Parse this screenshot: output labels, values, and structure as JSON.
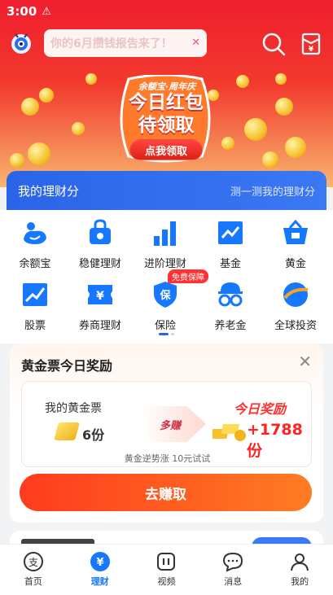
{
  "status_bar": {
    "time": "3:00",
    "indicator": "A-alert-icon"
  },
  "header": {
    "notice_text": "你的6月攒钱报告来了！",
    "icons": [
      "mascot-icon",
      "search-icon",
      "red-envelope-icon"
    ]
  },
  "promo": {
    "tag": "余额宝·周年庆",
    "title_line1": "今日红包",
    "title_line2": "待领取",
    "button": "点我领取"
  },
  "finance_bar": {
    "title": "我的理财分",
    "link": "测一测我的理财分"
  },
  "grid": {
    "items": [
      {
        "label": "余额宝",
        "icon": "yuebao-icon"
      },
      {
        "label": "稳健理财",
        "icon": "lock-bag-icon"
      },
      {
        "label": "进阶理财",
        "icon": "bar-chart-icon"
      },
      {
        "label": "基金",
        "icon": "fund-chart-icon"
      },
      {
        "label": "黄金",
        "icon": "gold-basket-icon"
      },
      {
        "label": "股票",
        "icon": "stock-trend-icon"
      },
      {
        "label": "券商理财",
        "icon": "yen-ticket-icon"
      },
      {
        "label": "保险",
        "icon": "insurance-shield-icon"
      },
      {
        "label": "养老金",
        "icon": "pension-icon"
      },
      {
        "label": "全球投资",
        "icon": "globe-icon"
      }
    ],
    "insurance_badge": "免费保障"
  },
  "reward": {
    "title": "黄金票今日奖励",
    "my_ticket_label": "我的黄金票",
    "my_ticket_value": "6份",
    "arrow_label": "多赚",
    "today_label": "今日奖励",
    "today_value": "+1788份",
    "tip": "黄金逆势涨 10元试试",
    "button": "去赚取"
  },
  "bottom_nav": [
    {
      "label": "首页",
      "icon": "alipay-icon",
      "active": false
    },
    {
      "label": "理财",
      "icon": "yen-coin-icon",
      "active": true
    },
    {
      "label": "视频",
      "icon": "video-icon",
      "active": false
    },
    {
      "label": "消息",
      "icon": "message-icon",
      "active": false
    },
    {
      "label": "我的",
      "icon": "person-icon",
      "active": false
    }
  ],
  "colors": {
    "brand_blue": "#1677ff",
    "banner_red": "#f01e2f",
    "reward_orange": "#ff5a1f"
  }
}
